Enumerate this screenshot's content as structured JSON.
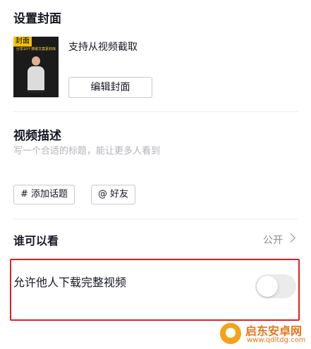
{
  "cover_section": {
    "title": "设置封面",
    "badge": "封面",
    "thumb_caption": "分享10个搜歌文案素材库",
    "thumb_footer": "..................",
    "support_text": "支持从视频截取",
    "edit_button": "编辑封面"
  },
  "description_section": {
    "title": "视频描述",
    "placeholder": "写一个合适的标题，能让更多人看到",
    "chips": [
      "# 添加话题",
      "@ 好友"
    ]
  },
  "visibility_row": {
    "label": "谁可以看",
    "value": "公开"
  },
  "download_row": {
    "label": "允许他人下载完整视频",
    "enabled": false
  },
  "watermark": {
    "title": "启东安卓网",
    "url": "www.qdltdg.com"
  }
}
